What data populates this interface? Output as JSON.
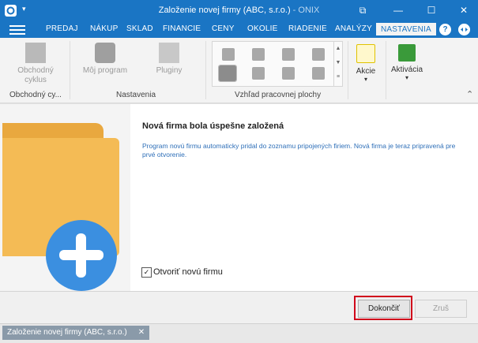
{
  "window": {
    "title": "Založenie novej firmy (ABC, s.r.o.)",
    "app_suffix": " - ONIX",
    "quick_access_glyph": "▾",
    "controls": {
      "restore_glyph": "⧉",
      "minimize_glyph": "—",
      "maximize_glyph": "☐",
      "close_glyph": "✕"
    }
  },
  "menu": {
    "tabs": [
      {
        "label": "PREDAJ"
      },
      {
        "label": "NÁKUP"
      },
      {
        "label": "SKLAD"
      },
      {
        "label": "FINANCIE"
      },
      {
        "label": "CENY"
      },
      {
        "label": "OKOLIE"
      },
      {
        "label": "RIADENIE"
      },
      {
        "label": "ANALÝZY"
      },
      {
        "label": "NASTAVENIA",
        "active": true
      }
    ],
    "help_glyph": "?"
  },
  "ribbon": {
    "items": [
      {
        "label": "Obchodný\ncyklus",
        "icon": "workflow-icon",
        "enabled": false
      },
      {
        "label": "Môj program",
        "icon": "gear-icon",
        "enabled": false
      },
      {
        "label": "Pluginy",
        "icon": "puzzle-icon",
        "enabled": false
      }
    ],
    "groups": [
      "Obchodný cy...",
      "Nastavenia",
      "Vzhľad pracovnej plochy"
    ],
    "gallery_scroll_glyphs": [
      "▲",
      "▼",
      "≡"
    ],
    "actions": [
      {
        "label": "Akcie",
        "icon": "actions-icon",
        "color": "#f2c400",
        "dropdown_glyph": "▾"
      },
      {
        "label": "Aktivácia",
        "icon": "key-icon",
        "color": "#3a9a3a",
        "dropdown_glyph": "▾"
      }
    ],
    "collapse_glyph": "⌃"
  },
  "content": {
    "heading": "Nová firma bola úspešne založená",
    "description": "Program novú firmu automaticky pridal do zoznamu pripojených firiem. Nová firma je teraz  pripravená pre prvé otvorenie.",
    "checkbox_label": "Otvoriť novú firmu",
    "checkbox_checked": true,
    "checkbox_glyph": "✓"
  },
  "footer": {
    "finish_label": "Dokončiť",
    "cancel_label": "Zruš"
  },
  "taskbar": {
    "tab_label": "Založenie novej firmy (ABC, s.r.o.)",
    "close_glyph": "✕"
  },
  "colors": {
    "title_bar": "#1a75c4",
    "accent": "#1a75c4",
    "highlight": "#d0021b",
    "folder": "#f4bb55",
    "plus_circle": "#3b8fe0"
  }
}
